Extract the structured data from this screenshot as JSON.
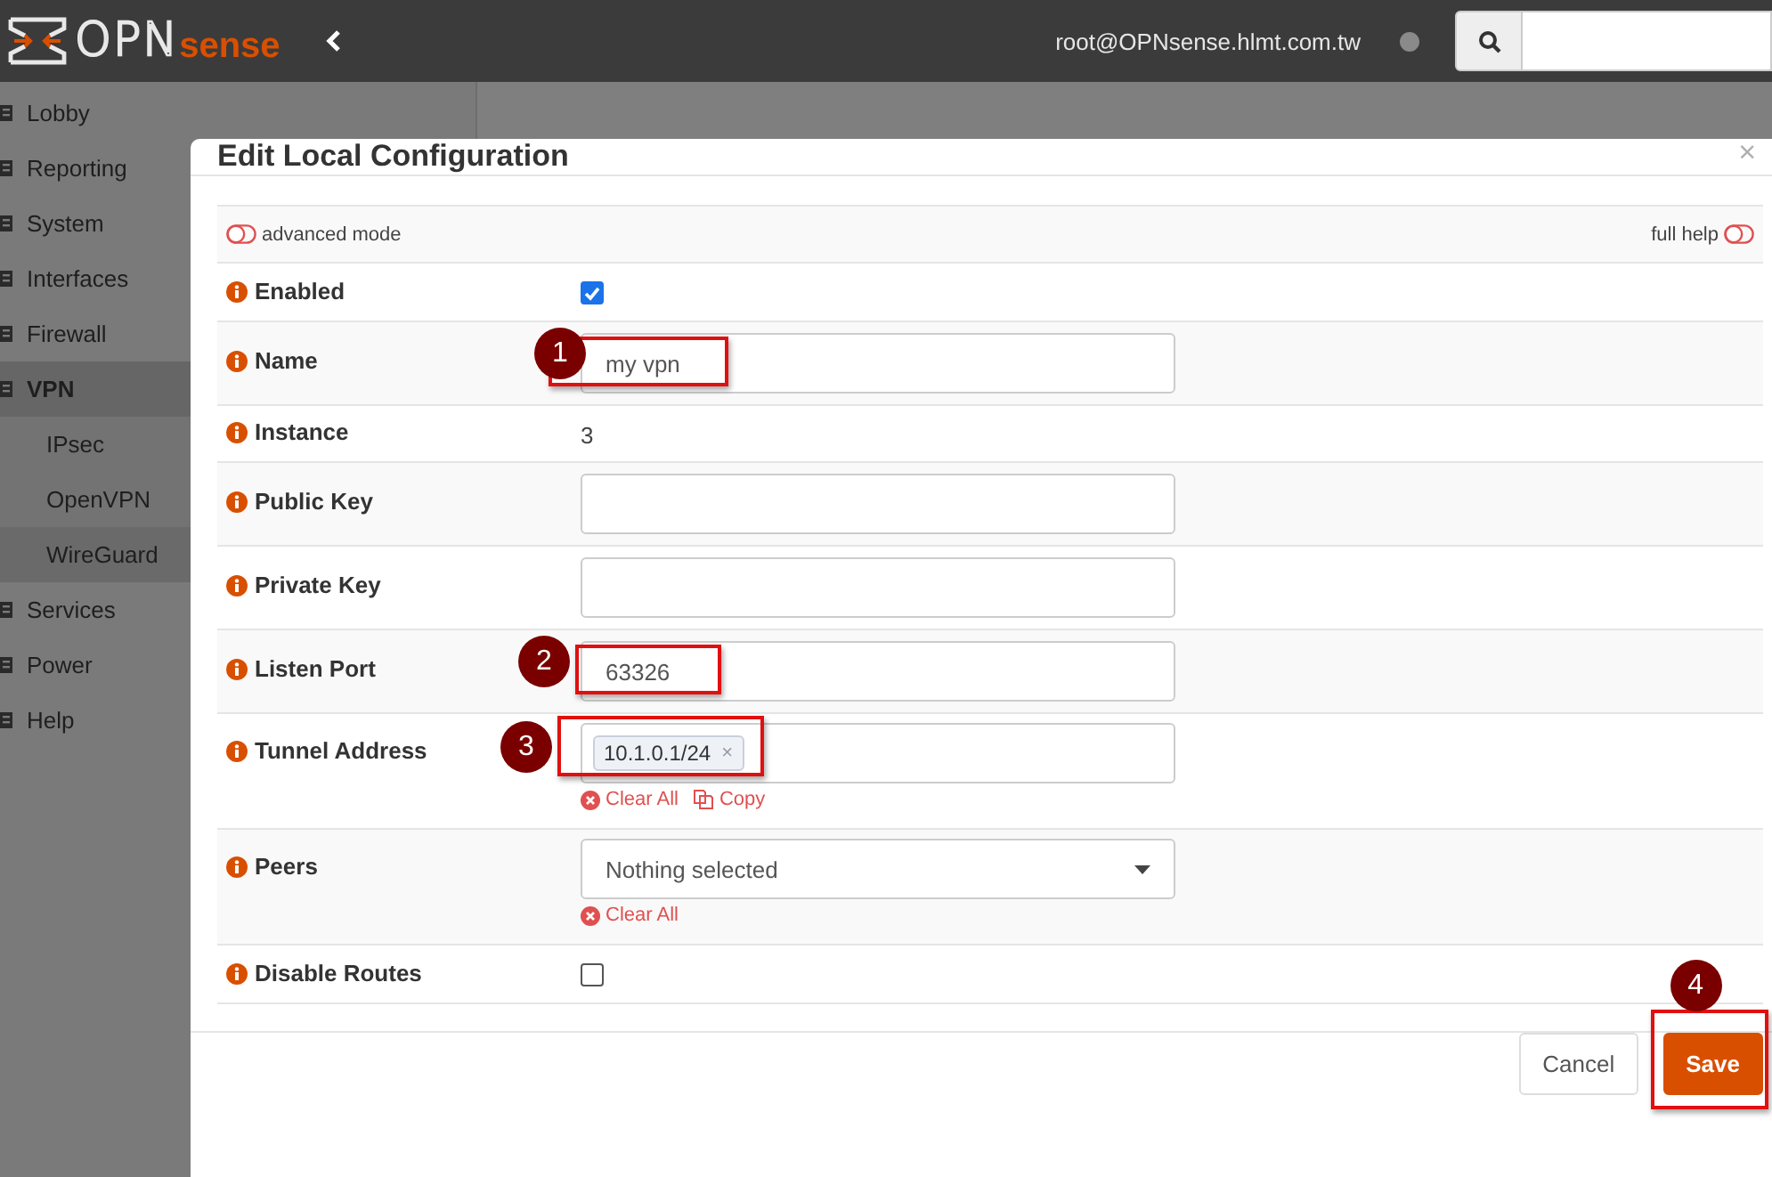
{
  "topbar": {
    "logo": {
      "main": "OPN",
      "accent": "sense"
    },
    "user": "root@OPNsense.hlmt.com.tw"
  },
  "sidebar": {
    "items": [
      {
        "label": "Lobby",
        "expanded": false
      },
      {
        "label": "Reporting",
        "expanded": false
      },
      {
        "label": "System",
        "expanded": false
      },
      {
        "label": "Interfaces",
        "expanded": false
      },
      {
        "label": "Firewall",
        "expanded": false
      },
      {
        "label": "VPN",
        "expanded": true,
        "children": [
          {
            "label": "IPsec",
            "selected": false
          },
          {
            "label": "OpenVPN",
            "selected": false
          },
          {
            "label": "WireGuard",
            "selected": true
          }
        ]
      },
      {
        "label": "Services",
        "expanded": false
      },
      {
        "label": "Power",
        "expanded": false
      },
      {
        "label": "Help",
        "expanded": false
      }
    ]
  },
  "modal": {
    "title": "Edit Local Configuration",
    "close": "×",
    "toggles": [
      {
        "label": "advanced mode",
        "on": false
      },
      {
        "label": "full help",
        "on": false
      }
    ],
    "fields": [
      {
        "kind": "checkbox",
        "label": "Enabled",
        "checked": true
      },
      {
        "kind": "text",
        "label": "Name",
        "value": "my vpn",
        "callout": "1"
      },
      {
        "kind": "static",
        "label": "Instance",
        "value": "3"
      },
      {
        "kind": "text",
        "label": "Public Key"
      },
      {
        "kind": "text",
        "label": "Private Key"
      },
      {
        "kind": "text",
        "label": "Listen Port",
        "value": "63326",
        "callout": "2"
      },
      {
        "kind": "tags",
        "label": "Tunnel Address",
        "tags": [
          {
            "label": "10.1.0.1/24",
            "remove": "×"
          }
        ],
        "actions": [
          {
            "kind": "clear",
            "label": "Clear All"
          },
          {
            "kind": "copy",
            "label": "Copy"
          }
        ],
        "callout": "3"
      },
      {
        "kind": "select",
        "label": "Peers",
        "value": "Nothing selected",
        "actions": [
          {
            "kind": "clear",
            "label": "Clear All"
          }
        ]
      },
      {
        "kind": "checkbox",
        "label": "Disable Routes",
        "checked": false
      }
    ],
    "buttons": [
      {
        "kind": "default",
        "label": "Cancel"
      },
      {
        "kind": "primary",
        "label": "Save",
        "callout": "4"
      }
    ]
  }
}
